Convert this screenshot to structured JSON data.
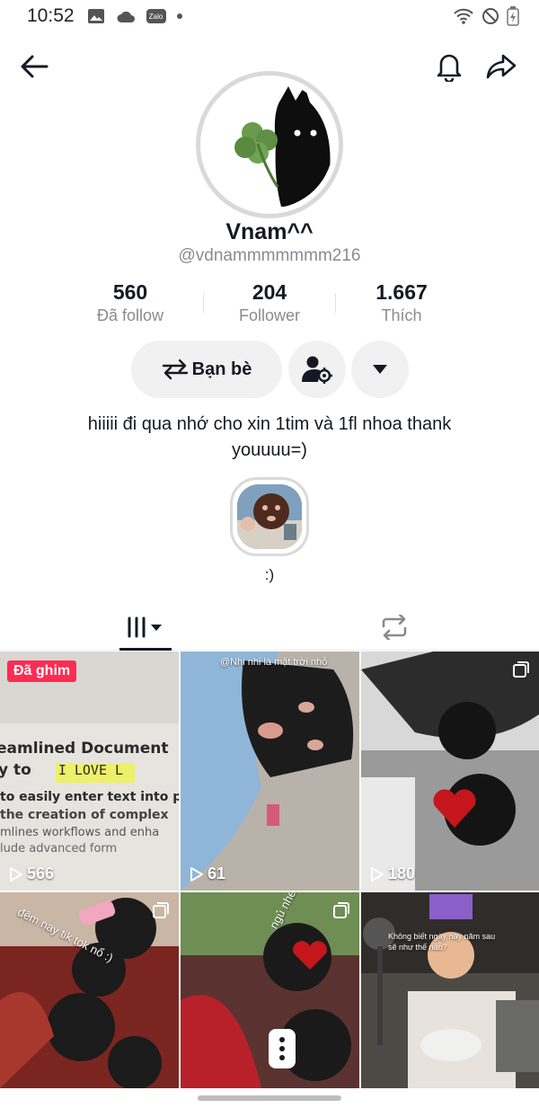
{
  "status_bar": {
    "time": "10:52",
    "icons_left": [
      "image-icon",
      "cloud-icon",
      "zalo-icon",
      "dot-icon"
    ],
    "zalo_label": "Zalo",
    "icons_right": [
      "wifi-icon",
      "do-not-disturb-icon",
      "battery-icon"
    ]
  },
  "nav": {
    "icons": [
      "back-arrow-icon",
      "bell-icon",
      "share-icon"
    ]
  },
  "profile": {
    "display_name": "Vnam^^",
    "username": "@vdnammmmmmm216",
    "stats": [
      {
        "value": "560",
        "label": "Đã follow"
      },
      {
        "value": "204",
        "label": "Follower"
      },
      {
        "value": "1.667",
        "label": "Thích"
      }
    ],
    "friends_button": "Bạn bè",
    "bio": "hiiiii đi qua nhớ cho xin 1tim và 1fl nhoa thank youuuu=)",
    "highlight_label": ":)"
  },
  "tabs": [
    {
      "name": "videos",
      "icon": "grid-icon",
      "active": true
    },
    {
      "name": "reposts",
      "icon": "repost-icon",
      "active": false
    }
  ],
  "videos": [
    {
      "views": "566",
      "pinned_label": "Đã ghim",
      "overlay_lines": [
        "eamlined Document",
        "y to",
        "I LOVE L",
        "to easily enter text into p",
        "the creation of complex",
        "mlines workflows and enha",
        "lude advanced form"
      ]
    },
    {
      "views": "61",
      "overlay_lines": [
        "@Nhi nhi là mặt trời nhỏ"
      ]
    },
    {
      "views": "180",
      "overlay_lines": []
    },
    {
      "views": "",
      "overlay_lines": [
        "đêm nay tik tok nổ :)"
      ]
    },
    {
      "views": "",
      "overlay_lines": [
        "ngủ nhé:)"
      ]
    },
    {
      "views": "",
      "overlay_lines": [
        "Không biết ngày này năm sau",
        "sẽ như thế nào?"
      ]
    }
  ],
  "colors": {
    "accent": "#fe2c55",
    "text_primary": "#161823",
    "text_secondary": "#8a8b91",
    "button_bg": "#f1f1f2"
  }
}
